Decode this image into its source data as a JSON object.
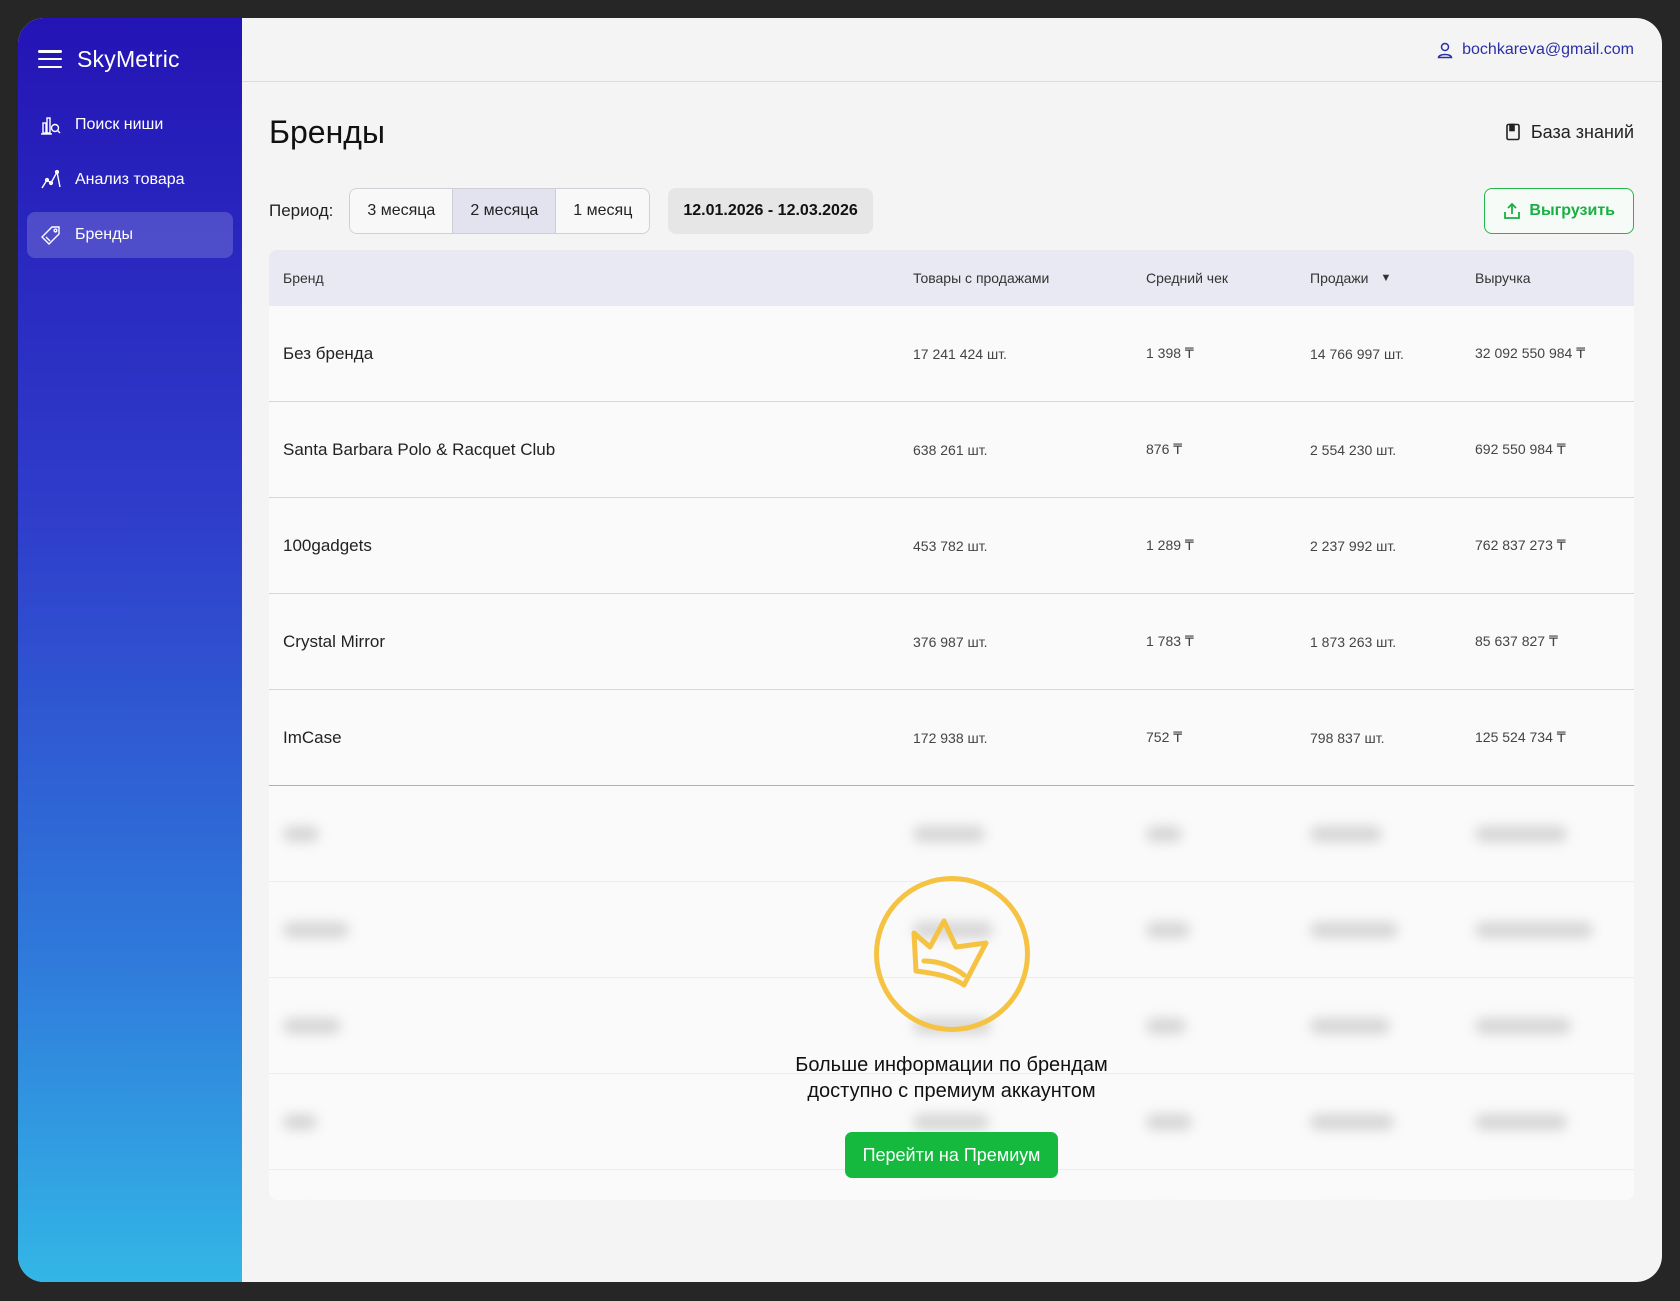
{
  "app": {
    "name": "SkyMetric"
  },
  "sidebar": {
    "items": [
      {
        "label": "Поиск ниши",
        "icon": "niche-search-icon",
        "active": false
      },
      {
        "label": "Анализ товара",
        "icon": "product-analysis-icon",
        "active": false
      },
      {
        "label": "Бренды",
        "icon": "tag-icon",
        "active": true
      }
    ]
  },
  "header": {
    "user_email": "bochkareva@gmail.com"
  },
  "page": {
    "title": "Бренды",
    "knowledge_base": "База знаний"
  },
  "toolbar": {
    "period_label": "Период:",
    "periods": [
      "3 месяца",
      "2 месяца",
      "1 месяц"
    ],
    "active_period": "2 месяца",
    "date_range": "12.01.2026 - 12.03.2026",
    "export_label": "Выгрузить"
  },
  "table": {
    "columns": [
      "Бренд",
      "Товары с продажами",
      "Средний чек",
      "Продажи",
      "Выручка"
    ],
    "sorted_column": "Продажи",
    "rows": [
      {
        "brand": "Без бренда",
        "items": "17 241 424 шт.",
        "avg": "1 398 ₸",
        "sales": "14 766 997 шт.",
        "revenue": "32 092 550 984 ₸"
      },
      {
        "brand": "Santa Barbara Polo & Racquet Club",
        "items": "638 261 шт.",
        "avg": "876 ₸",
        "sales": "2 554 230 шт.",
        "revenue": "692 550 984 ₸"
      },
      {
        "brand": "100gadgets",
        "items": "453 782 шт.",
        "avg": "1 289 ₸",
        "sales": "2 237 992 шт.",
        "revenue": "762 837 273 ₸"
      },
      {
        "brand": "Crystal Mirror",
        "items": "376 987 шт.",
        "avg": "1 783 ₸",
        "sales": "1 873 263 шт.",
        "revenue": "85 637 827 ₸"
      },
      {
        "brand": "ImCase",
        "items": "172 938 шт.",
        "avg": "752 ₸",
        "sales": "798 837 шт.",
        "revenue": "125 524 734 ₸"
      }
    ]
  },
  "premium": {
    "text_line1": "Больше информации по брендам",
    "text_line2": "доступно с премиум аккаунтом",
    "button": "Перейти на Премиум",
    "icon": "crown-icon"
  },
  "colors": {
    "accent_green": "#14b93e",
    "crown_yellow": "#f5c242",
    "sidebar_top": "#2414b5",
    "sidebar_bottom": "#33b6e6"
  }
}
